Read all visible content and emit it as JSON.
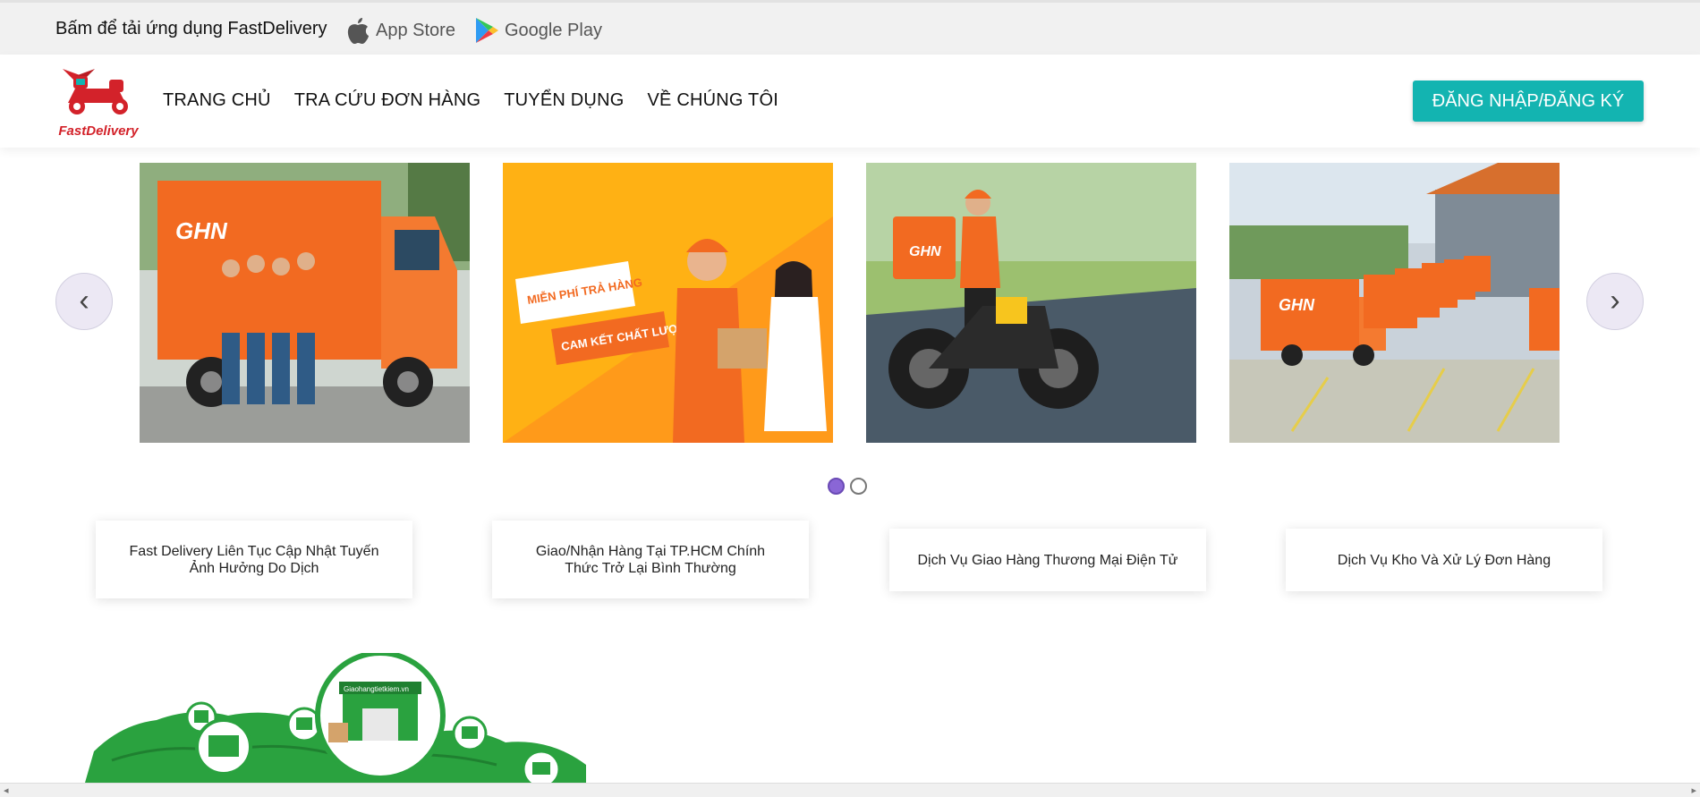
{
  "topbar": {
    "promo_text": "Bấm để tải ứng dụng FastDelivery",
    "app_store_label": "App Store",
    "google_play_label": "Google Play"
  },
  "header": {
    "logo_text": "FastDelivery",
    "nav": [
      "TRANG CHỦ",
      "TRA CỨU ĐƠN HÀNG",
      "TUYỂN DỤNG",
      "VỀ CHÚNG TÔI"
    ],
    "login_label": "ĐĂNG NHẬP/ĐĂNG KÝ"
  },
  "carousel": {
    "prev_symbol": "‹",
    "next_symbol": "›",
    "slides": [
      {
        "truck_logo": "GHN"
      },
      {
        "line1": "MIỄN PHÍ TRẢ HÀNG",
        "line2": "CAM KẾT CHẤT LƯỢNG"
      },
      {
        "box_logo": "GHN"
      },
      {
        "truck_logo": "GHN"
      }
    ],
    "pages": 2,
    "active_page": 1
  },
  "news": [
    "Fast Delivery Liên Tục Cập Nhật Tuyến Ảnh Hưởng Do Dịch",
    "Giao/Nhận Hàng Tại TP.HCM Chính Thức Trở Lại Bình Thường",
    "Dịch Vụ Giao Hàng Thương Mại Điện Tử",
    "Dịch Vụ Kho Và Xử Lý Đơn Hàng"
  ],
  "map": {
    "warehouse_sign": "Giaohangtietkiem.vn"
  },
  "colors": {
    "accent": "#13b4b1",
    "brand_red": "#d3222a",
    "ghn_orange": "#f26a21",
    "map_green": "#2aa23f"
  }
}
